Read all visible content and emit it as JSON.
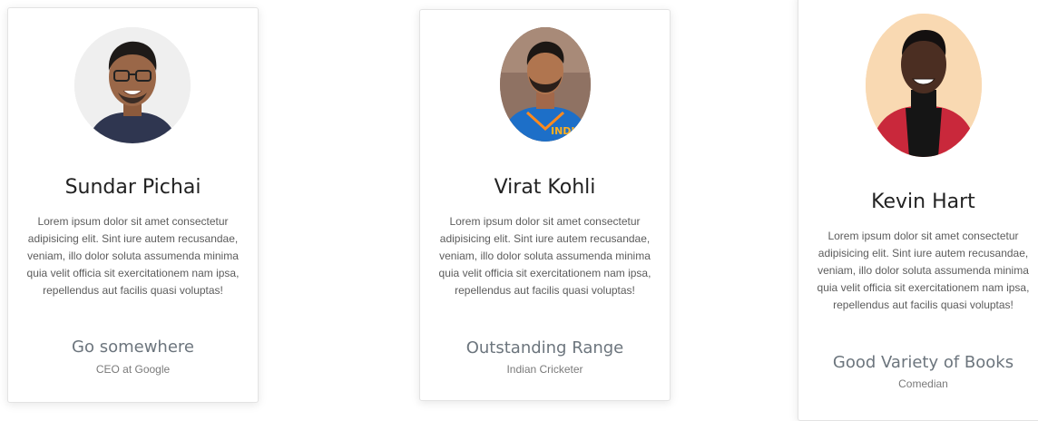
{
  "cards": [
    {
      "name": "Sundar Pichai",
      "bio": "Lorem ipsum dolor sit amet consectetur adipisicing elit. Sint iure autem recusandae, veniam, illo dolor soluta assumenda minima quia velit officia sit exercitationem nam ipsa, repellendus aut facilis quasi voluptas!",
      "title": "Go somewhere",
      "subtitle": "CEO at Google"
    },
    {
      "name": "Virat Kohli",
      "bio": "Lorem ipsum dolor sit amet consectetur adipisicing elit. Sint iure autem recusandae, veniam, illo dolor soluta assumenda minima quia velit officia sit exercitationem nam ipsa, repellendus aut facilis quasi voluptas!",
      "title": "Outstanding Range",
      "subtitle": "Indian Cricketer"
    },
    {
      "name": "Kevin Hart",
      "bio": "Lorem ipsum dolor sit amet consectetur adipisicing elit. Sint iure autem recusandae, veniam, illo dolor soluta assumenda minima quia velit officia sit exercitationem nam ipsa, repellendus aut facilis quasi voluptas!",
      "title": "Good Variety of Books",
      "subtitle": "Comedian"
    }
  ],
  "colors": {
    "name_text": "#222222",
    "body_text": "#5c5c5c",
    "title_text": "#6c757d",
    "card_border": "#e3e3e3"
  }
}
